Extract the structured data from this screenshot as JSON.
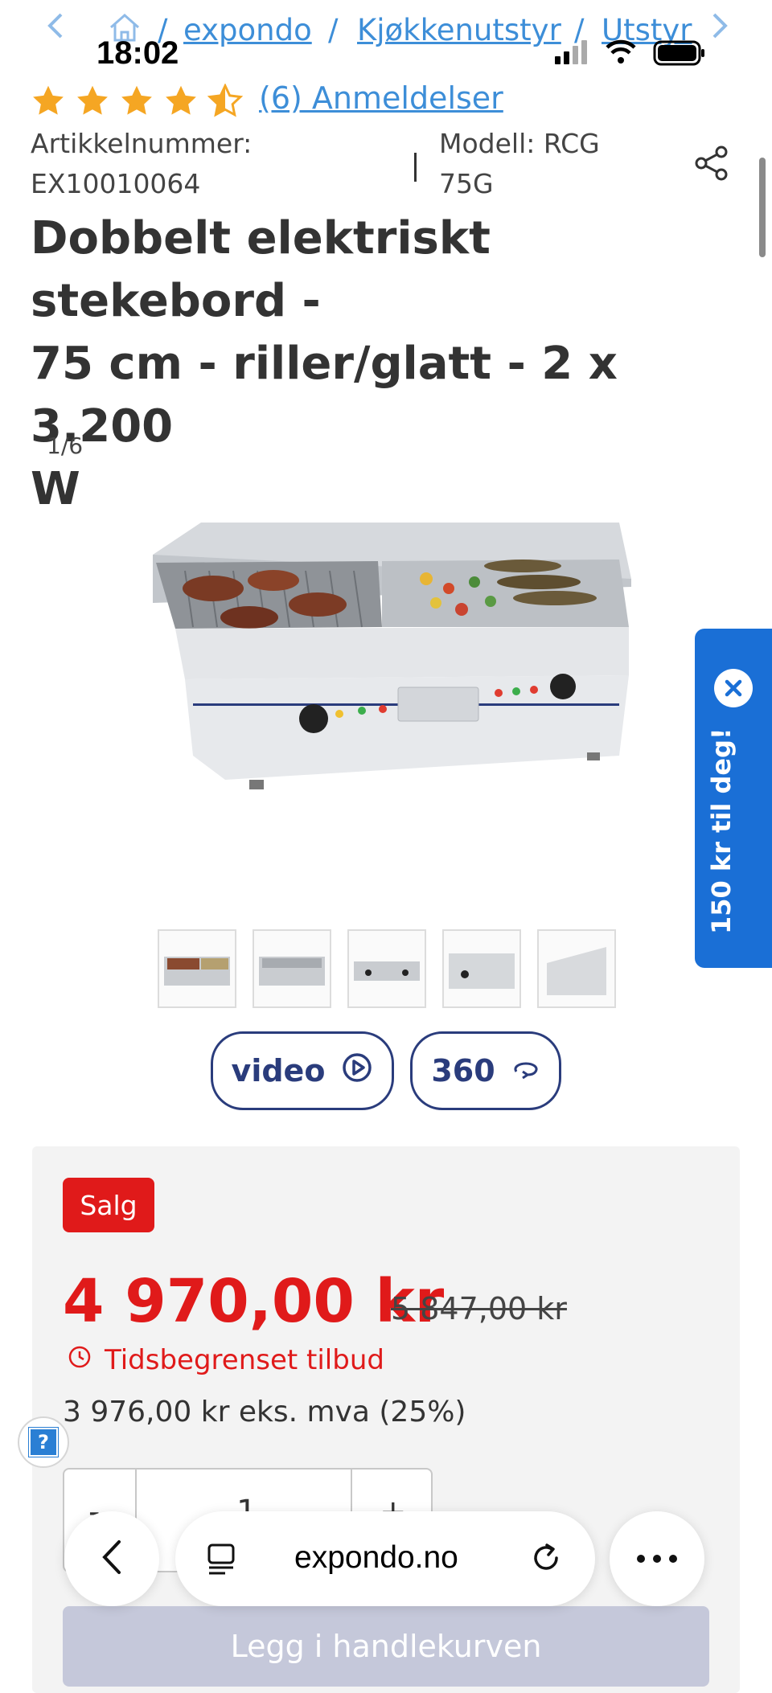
{
  "breadcrumb": {
    "back_icon": "chevron-left-icon",
    "home_icon": "home-icon",
    "items": [
      "expondo",
      "Kjøkkenutstyr",
      "Utstyr"
    ],
    "separator": "/",
    "forward_icon": "chevron-right-icon"
  },
  "status_bar": {
    "time": "18:02",
    "icons": [
      "cellular-signal-icon",
      "wifi-icon",
      "battery-icon"
    ]
  },
  "rating": {
    "stars": 4.5,
    "reviews_label": "(6) Anmeldelser",
    "star_color": "#f5a623"
  },
  "meta": {
    "article_label": "Artikkelnummer:",
    "article_value": "EX10010064",
    "separator": "|",
    "model_line1": "Modell: RCG",
    "model_line2": "75G",
    "share_icon": "share-icon"
  },
  "product": {
    "title_line1": "Dobbelt elektriskt stekebord -",
    "title_line2": "75 cm - riller/glatt - 2 x 3.200",
    "title_line3": "W",
    "image_counter": "1/6",
    "thumbnail_count": 5
  },
  "media": {
    "video_label": "video",
    "video_icon": "play-circle-icon",
    "spin_label": "360",
    "spin_icon": "rotate-360-icon"
  },
  "promo": {
    "text": "150 kr til deg!",
    "close_icon": "close-icon",
    "color": "#1a6fd6"
  },
  "pricing": {
    "badge": "Salg",
    "price": "4 970,00 kr",
    "old_price": "5 847,00 kr",
    "limited_offer": "Tidsbegrenset tilbud",
    "clock_icon": "clock-icon",
    "ex_vat": "3 976,00 kr eks. mva (25%)",
    "accent": "#e01a1a"
  },
  "quantity": {
    "minus": "-",
    "value": "1",
    "plus": "+"
  },
  "cart": {
    "button_label": "Legg i handlekurven"
  },
  "help": {
    "label": "?"
  },
  "browser": {
    "back_icon": "chevron-left-icon",
    "tabs_icon": "reader-icon",
    "url": "expondo.no",
    "reload_icon": "reload-icon",
    "more_icon": "more-icon"
  }
}
